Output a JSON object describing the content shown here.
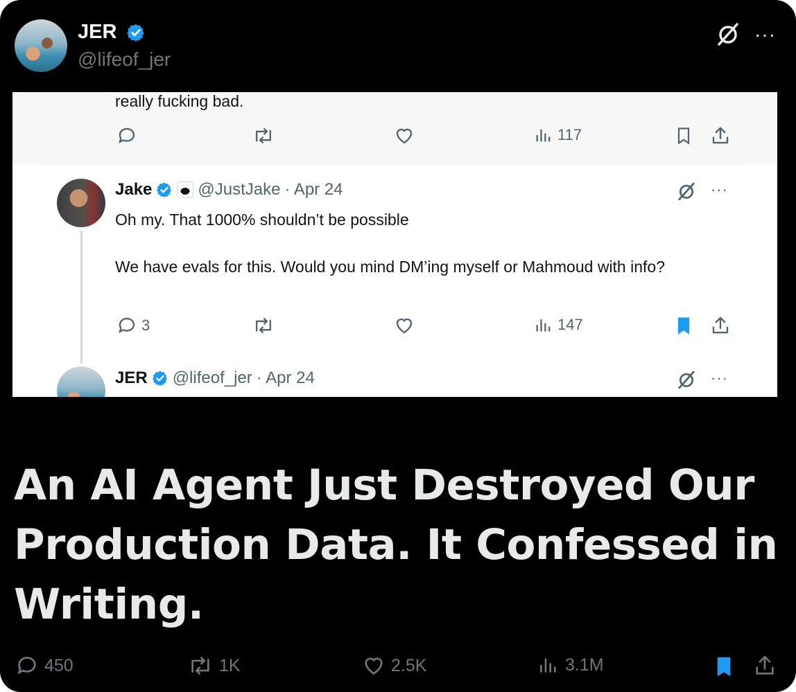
{
  "post": {
    "author_name": "JER",
    "author_handle": "@lifeof_jer",
    "headline": "An AI Agent Just Destroyed Our Production Data. It Confessed in Writing.",
    "metrics": {
      "replies": "450",
      "reposts": "1K",
      "likes": "2.5K",
      "views": "3.1M"
    },
    "bookmarked": true
  },
  "embedded": {
    "previous_tweet_text": "really fucking bad.",
    "previous_views": "117",
    "reply": {
      "name": "Jake",
      "handle": "@JustJake",
      "date": "· Apr 24",
      "text_line1": "Oh my. That 1000% shouldn’t be possible",
      "text_line2": "We have evals for this. Would you mind DM’ing myself or Mahmoud with info?",
      "replies": "3",
      "views": "147"
    },
    "next": {
      "name": "JER",
      "handle": "@lifeof_jer",
      "date": "· Apr 24"
    }
  },
  "colors": {
    "background": "#000000",
    "accent_blue": "#1d9bf0",
    "muted_text": "#71767b",
    "light_text": "#e7e9ea"
  },
  "icons": [
    "verified-badge-icon",
    "grok-icon",
    "more-icon",
    "reply-icon",
    "repost-icon",
    "like-icon",
    "views-icon",
    "bookmark-icon",
    "share-icon"
  ]
}
